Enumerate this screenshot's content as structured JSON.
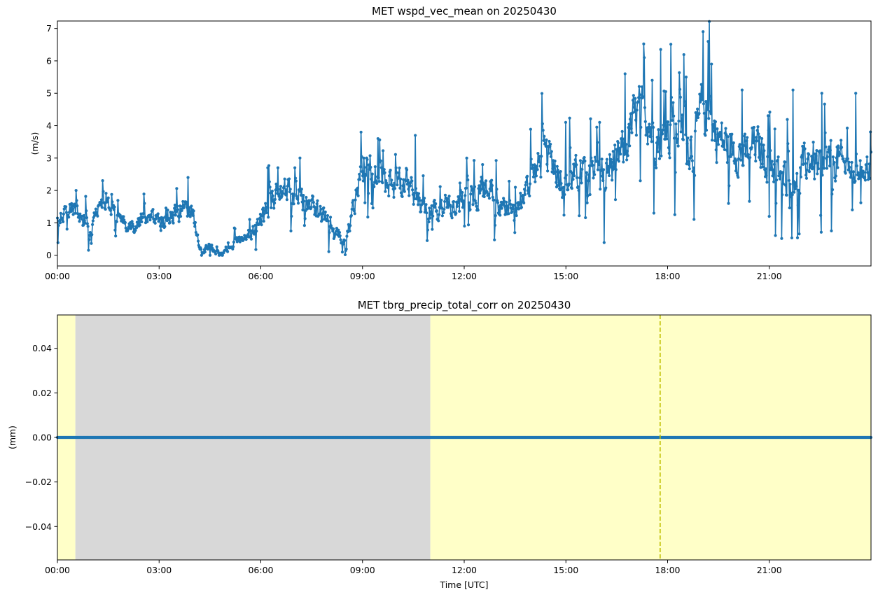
{
  "chart_data": [
    {
      "type": "line",
      "title": "MET wspd_vec_mean on 20250430",
      "xlabel": "",
      "ylabel": "(m/s)",
      "x_unit": "hours UTC",
      "xlim": [
        0,
        24
      ],
      "ylim": [
        -0.33,
        7.23
      ],
      "x_ticks": [
        0,
        3,
        6,
        9,
        12,
        15,
        18,
        21
      ],
      "x_tick_labels": [
        "00:00",
        "03:00",
        "06:00",
        "09:00",
        "12:00",
        "15:00",
        "18:00",
        "21:00"
      ],
      "y_ticks": [
        0,
        1,
        2,
        3,
        4,
        5,
        6,
        7
      ],
      "y_tick_labels": [
        "0",
        "1",
        "2",
        "3",
        "4",
        "5",
        "6",
        "7"
      ],
      "grid": false,
      "legend": "none",
      "series": [
        {
          "color": "#1f77b4",
          "marker": "circle",
          "x": [
            0,
            0.25,
            0.5,
            0.6,
            0.75,
            1.0,
            1.25,
            1.5,
            1.75,
            2.0,
            2.25,
            2.5,
            2.75,
            3.0,
            3.25,
            3.5,
            3.75,
            4.0,
            4.1,
            4.25,
            4.5,
            4.75,
            5.0,
            5.25,
            5.5,
            5.75,
            6.0,
            6.25,
            6.5,
            6.75,
            7.0,
            7.25,
            7.5,
            7.75,
            8.0,
            8.25,
            8.5,
            8.75,
            9.0,
            9.25,
            9.5,
            9.75,
            10.0,
            10.25,
            10.5,
            10.75,
            11.0,
            11.25,
            11.5,
            11.75,
            12.0,
            12.25,
            12.5,
            12.75,
            13.0,
            13.25,
            13.5,
            13.75,
            14.0,
            14.25,
            14.5,
            14.75,
            15.0,
            15.25,
            15.5,
            15.75,
            16.0,
            16.25,
            16.5,
            16.75,
            17.0,
            17.25,
            17.5,
            17.75,
            18.0,
            18.25,
            18.5,
            18.75,
            19.0,
            19.25,
            19.5,
            19.75,
            20.0,
            20.25,
            20.5,
            20.75,
            21.0,
            21.25,
            21.5,
            21.75,
            22.0,
            22.25,
            22.5,
            22.75,
            23.0,
            23.25,
            23.5,
            23.75,
            24.0
          ],
          "y": [
            1.1,
            1.3,
            1.5,
            1.2,
            1.1,
            0.9,
            1.6,
            1.5,
            1.2,
            1.0,
            0.9,
            1.1,
            1.2,
            1.0,
            1.3,
            1.2,
            1.4,
            1.3,
            0.6,
            0.1,
            0.3,
            0.0,
            0.1,
            0.4,
            0.5,
            0.7,
            1.0,
            1.6,
            1.8,
            2.0,
            1.9,
            1.7,
            1.6,
            1.3,
            1.0,
            0.6,
            0.4,
            1.5,
            2.9,
            2.7,
            2.4,
            2.2,
            2.0,
            2.4,
            1.8,
            1.6,
            1.4,
            1.3,
            1.6,
            1.5,
            1.7,
            1.8,
            2.0,
            2.1,
            1.6,
            1.4,
            1.2,
            1.9,
            2.4,
            2.9,
            3.1,
            2.6,
            2.2,
            2.4,
            2.6,
            2.9,
            2.5,
            2.7,
            3.0,
            3.3,
            4.2,
            4.6,
            3.9,
            3.5,
            3.7,
            4.0,
            3.6,
            3.3,
            4.6,
            4.1,
            3.6,
            3.4,
            3.3,
            3.0,
            3.5,
            3.2,
            2.8,
            2.6,
            2.4,
            2.5,
            2.8,
            3.0,
            2.6,
            2.8,
            3.0,
            2.7,
            2.6,
            2.8,
            2.7
          ],
          "y_spread": [
            0.3,
            0.4,
            0.4,
            0.3,
            0.4,
            0.3,
            0.3,
            0.3,
            0.3,
            0.3,
            0.3,
            0.3,
            0.3,
            0.4,
            0.4,
            0.5,
            0.4,
            0.4,
            0.3,
            0.1,
            0.2,
            0.1,
            0.1,
            0.2,
            0.2,
            0.3,
            0.4,
            0.5,
            0.6,
            0.6,
            0.6,
            0.5,
            0.5,
            0.5,
            0.5,
            0.4,
            0.3,
            0.6,
            0.7,
            0.7,
            0.7,
            0.7,
            0.7,
            0.7,
            0.6,
            0.6,
            0.5,
            0.5,
            0.5,
            0.5,
            0.5,
            0.6,
            0.6,
            0.6,
            0.6,
            0.5,
            0.5,
            0.6,
            0.7,
            0.8,
            0.8,
            0.8,
            0.8,
            0.8,
            0.8,
            0.8,
            0.8,
            0.9,
            0.9,
            1.0,
            1.1,
            1.1,
            1.1,
            1.0,
            1.1,
            1.1,
            1.1,
            1.1,
            1.2,
            1.2,
            1.1,
            1.0,
            1.0,
            0.9,
            0.9,
            0.9,
            0.8,
            0.8,
            0.8,
            0.8,
            0.8,
            0.9,
            0.9,
            0.9,
            0.9,
            0.8,
            0.7,
            0.7,
            0.7
          ],
          "peaks": [
            {
              "x": 0.55,
              "y": 2.0
            },
            {
              "x": 3.85,
              "y": 2.4
            },
            {
              "x": 6.2,
              "y": 2.7
            },
            {
              "x": 6.5,
              "y": 2.7
            },
            {
              "x": 7.0,
              "y": 2.7
            },
            {
              "x": 8.95,
              "y": 3.8
            },
            {
              "x": 9.45,
              "y": 3.6
            },
            {
              "x": 10.55,
              "y": 3.7
            },
            {
              "x": 12.55,
              "y": 2.8
            },
            {
              "x": 15.0,
              "y": 4.1
            },
            {
              "x": 16.0,
              "y": 4.1
            },
            {
              "x": 16.75,
              "y": 5.6
            },
            {
              "x": 17.55,
              "y": 5.4
            },
            {
              "x": 17.8,
              "y": 6.35
            },
            {
              "x": 18.55,
              "y": 5.5
            },
            {
              "x": 19.05,
              "y": 6.9
            },
            {
              "x": 19.2,
              "y": 6.6
            },
            {
              "x": 19.3,
              "y": 5.9
            },
            {
              "x": 20.2,
              "y": 5.1
            },
            {
              "x": 21.7,
              "y": 5.1
            },
            {
              "x": 22.55,
              "y": 5.0
            },
            {
              "x": 23.55,
              "y": 5.0
            }
          ],
          "troughs": [
            {
              "x": 4.5,
              "y": 0.0
            },
            {
              "x": 8.4,
              "y": 0.1
            },
            {
              "x": 11.05,
              "y": 0.8
            },
            {
              "x": 12.0,
              "y": 0.9
            },
            {
              "x": 13.5,
              "y": 0.7
            },
            {
              "x": 17.2,
              "y": 2.3
            },
            {
              "x": 17.6,
              "y": 1.3
            },
            {
              "x": 19.8,
              "y": 1.6
            },
            {
              "x": 21.0,
              "y": 1.2
            }
          ]
        }
      ]
    },
    {
      "type": "line",
      "title": "MET tbrg_precip_total_corr on 20250430",
      "xlabel": "Time [UTC]",
      "ylabel": "(mm)",
      "x_unit": "hours UTC",
      "xlim": [
        0,
        24
      ],
      "ylim": [
        -0.055,
        0.055
      ],
      "x_ticks": [
        0,
        3,
        6,
        9,
        12,
        15,
        18,
        21
      ],
      "x_tick_labels": [
        "00:00",
        "03:00",
        "06:00",
        "09:00",
        "12:00",
        "15:00",
        "18:00",
        "21:00"
      ],
      "y_ticks": [
        0.04,
        0.02,
        0.0,
        -0.02,
        -0.04
      ],
      "y_tick_labels": [
        "0.04",
        "0.02",
        "0.00",
        "−0.02",
        "−0.04"
      ],
      "grid": false,
      "legend": "none",
      "shaded_regions": [
        {
          "x_start": 0.0,
          "x_end": 0.53,
          "color": "#ffffc8"
        },
        {
          "x_start": 0.53,
          "x_end": 11.0,
          "color": "#d8d8d8"
        },
        {
          "x_start": 11.0,
          "x_end": 24.0,
          "color": "#ffffc8"
        }
      ],
      "vertical_lines": [
        {
          "x": 17.78,
          "color": "#bfbf00",
          "style": "dashed"
        }
      ],
      "series": [
        {
          "color": "#1f77b4",
          "marker": "circle",
          "x_range": [
            0,
            24
          ],
          "y_constant": 0.0
        }
      ]
    }
  ]
}
